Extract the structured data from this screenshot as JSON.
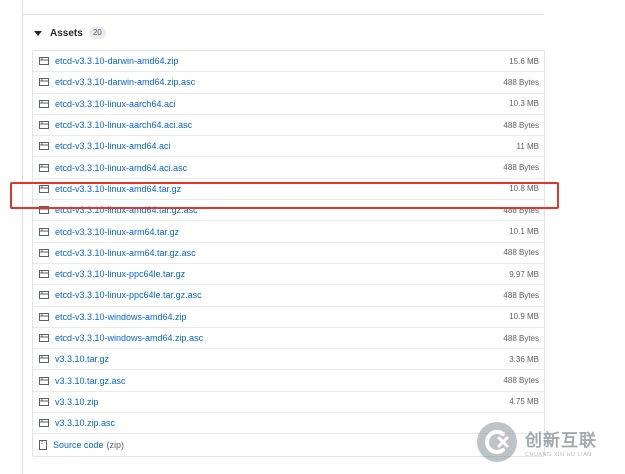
{
  "release": {
    "assets_label": "Assets",
    "assets_count": "20",
    "assets": [
      {
        "name": "etcd-v3.3.10-darwin-amd64.zip",
        "size": "15.6 MB"
      },
      {
        "name": "etcd-v3.3.10-darwin-amd64.zip.asc",
        "size": "488 Bytes"
      },
      {
        "name": "etcd-v3.3.10-linux-aarch64.aci",
        "size": "10.3 MB"
      },
      {
        "name": "etcd-v3.3.10-linux-aarch64.aci.asc",
        "size": "488 Bytes"
      },
      {
        "name": "etcd-v3.3.10-linux-amd64.aci",
        "size": "11 MB"
      },
      {
        "name": "etcd-v3.3.10-linux-amd64.aci.asc",
        "size": "488 Bytes"
      },
      {
        "name": "etcd-v3.3.10-linux-amd64.tar.gz",
        "size": "10.8 MB"
      },
      {
        "name": "etcd-v3.3.10-linux-amd64.tar.gz.asc",
        "size": "488 Bytes"
      },
      {
        "name": "etcd-v3.3.10-linux-arm64.tar.gz",
        "size": "10.1 MB"
      },
      {
        "name": "etcd-v3.3.10-linux-arm64.tar.gz.asc",
        "size": "488 Bytes"
      },
      {
        "name": "etcd-v3.3.10-linux-ppc64le.tar.gz",
        "size": "9.97 MB"
      },
      {
        "name": "etcd-v3.3.10-linux-ppc64le.tar.gz.asc",
        "size": "488 Bytes"
      },
      {
        "name": "etcd-v3.3.10-windows-amd64.zip",
        "size": "10.9 MB"
      },
      {
        "name": "etcd-v3.3.10-windows-amd64.zip.asc",
        "size": "488 Bytes"
      },
      {
        "name": "v3.3.10.tar.gz",
        "size": "3.36 MB"
      },
      {
        "name": "v3.3.10.tar.gz.asc",
        "size": "488 Bytes"
      },
      {
        "name": "v3.3.10.zip",
        "size": "4.75 MB"
      },
      {
        "name": "v3.3.10.zip.asc",
        "size": ""
      }
    ],
    "source_code": {
      "label": "Source code",
      "suffix": "(zip)"
    }
  },
  "watermark": {
    "main": "创新互联",
    "sub": "CHUANG XIN HU LIAN"
  },
  "colors": {
    "link": "#0366d6",
    "highlight": "#e2362a"
  },
  "icons": {
    "asset": "package-icon",
    "source": "file-zip-icon",
    "toggle": "triangle-down-icon"
  }
}
